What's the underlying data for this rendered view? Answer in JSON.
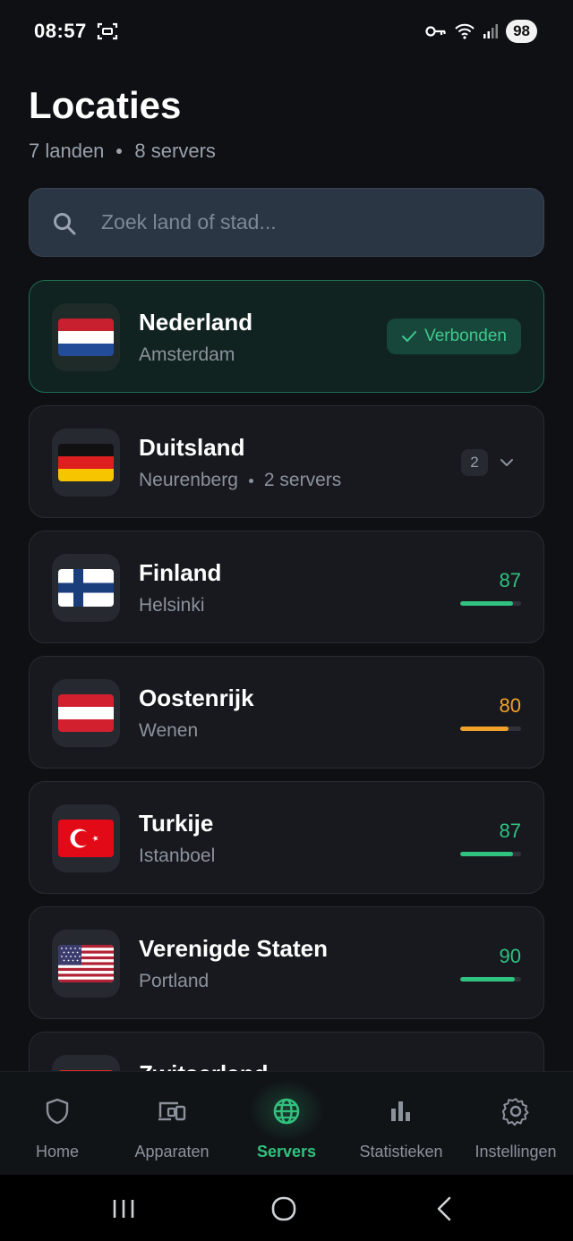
{
  "status_bar": {
    "time": "08:57",
    "battery": "98"
  },
  "header": {
    "title": "Locaties",
    "countries": "7 landen",
    "servers": "8 servers"
  },
  "search": {
    "placeholder": "Zoek land of stad..."
  },
  "locations": [
    {
      "country": "Nederland",
      "city": "Amsterdam",
      "status": "Verbonden",
      "flag": "nl"
    },
    {
      "country": "Duitsland",
      "city": "Neurenberg",
      "servers_note": "2 servers",
      "server_count": "2",
      "flag": "de"
    },
    {
      "country": "Finland",
      "city": "Helsinki",
      "load": "87",
      "load_color": "#2fc281",
      "flag": "fi"
    },
    {
      "country": "Oostenrijk",
      "city": "Wenen",
      "load": "80",
      "load_color": "#f0a12b",
      "flag": "at"
    },
    {
      "country": "Turkije",
      "city": "Istanboel",
      "load": "87",
      "load_color": "#2fc281",
      "flag": "tr"
    },
    {
      "country": "Verenigde Staten",
      "city": "Portland",
      "load": "90",
      "load_color": "#2fc281",
      "flag": "us"
    },
    {
      "country": "Zwitserland",
      "flag": "ch"
    }
  ],
  "nav": {
    "items": [
      {
        "label": "Home",
        "icon": "shield-icon"
      },
      {
        "label": "Apparaten",
        "icon": "devices-icon"
      },
      {
        "label": "Servers",
        "icon": "globe-icon",
        "active": true
      },
      {
        "label": "Statistieken",
        "icon": "bar-chart-icon"
      },
      {
        "label": "Instellingen",
        "icon": "gear-icon"
      }
    ]
  },
  "colors": {
    "accent": "#32c07e",
    "warning": "#f0a12b",
    "background": "#0e1014",
    "card": "#17191e"
  }
}
